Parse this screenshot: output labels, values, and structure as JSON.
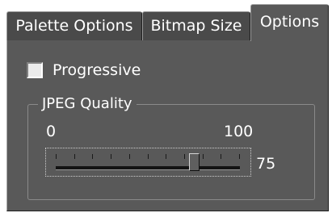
{
  "tabs": [
    {
      "label": "Palette Options",
      "active": false
    },
    {
      "label": "Bitmap Size",
      "active": false
    },
    {
      "label": "Options",
      "active": true
    }
  ],
  "options": {
    "progressive": {
      "label": "Progressive",
      "checked": false
    },
    "jpeg_quality": {
      "group_title": "JPEG Quality",
      "min_label": "0",
      "max_label": "100",
      "min": 0,
      "max": 100,
      "value": 75,
      "value_label": "75"
    }
  }
}
